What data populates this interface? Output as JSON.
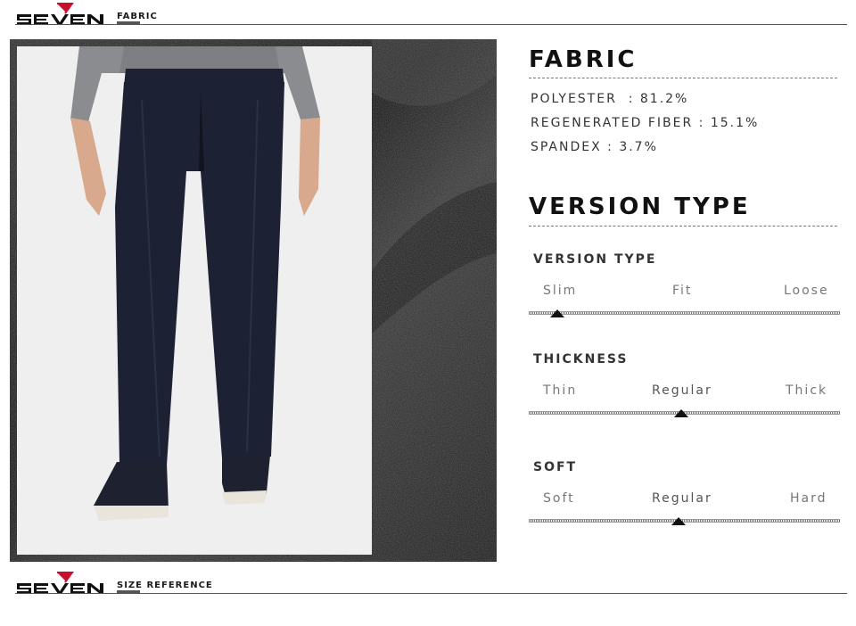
{
  "brand": {
    "logo_text": "SEVEN",
    "accent": "#c8102e"
  },
  "top_header": {
    "tag": "FABRIC"
  },
  "bottom_header": {
    "tag": "SIZE REFERENCE"
  },
  "fabric": {
    "title": "FABRIC",
    "specs": [
      "POLYESTER  : 81.2%",
      "REGENERATED FIBER : 15.1%",
      "SPANDEX : 3.7%"
    ]
  },
  "version_type": {
    "title": "VERSION TYPE",
    "groups": [
      {
        "label": "VERSION TYPE",
        "options": [
          "Slim",
          "Fit",
          "Loose"
        ],
        "selected_index": 0
      },
      {
        "label": "THICKNESS",
        "options": [
          "Thin",
          "Regular",
          "Thick"
        ],
        "selected_index": 1
      },
      {
        "label": "SOFT",
        "options": [
          "Soft",
          "Regular",
          "Hard"
        ],
        "selected_index": 1
      }
    ]
  },
  "colors": {
    "text": "#111111",
    "muted": "#777777",
    "photo_bg": "#efefef",
    "trouser": "#1c2133"
  }
}
